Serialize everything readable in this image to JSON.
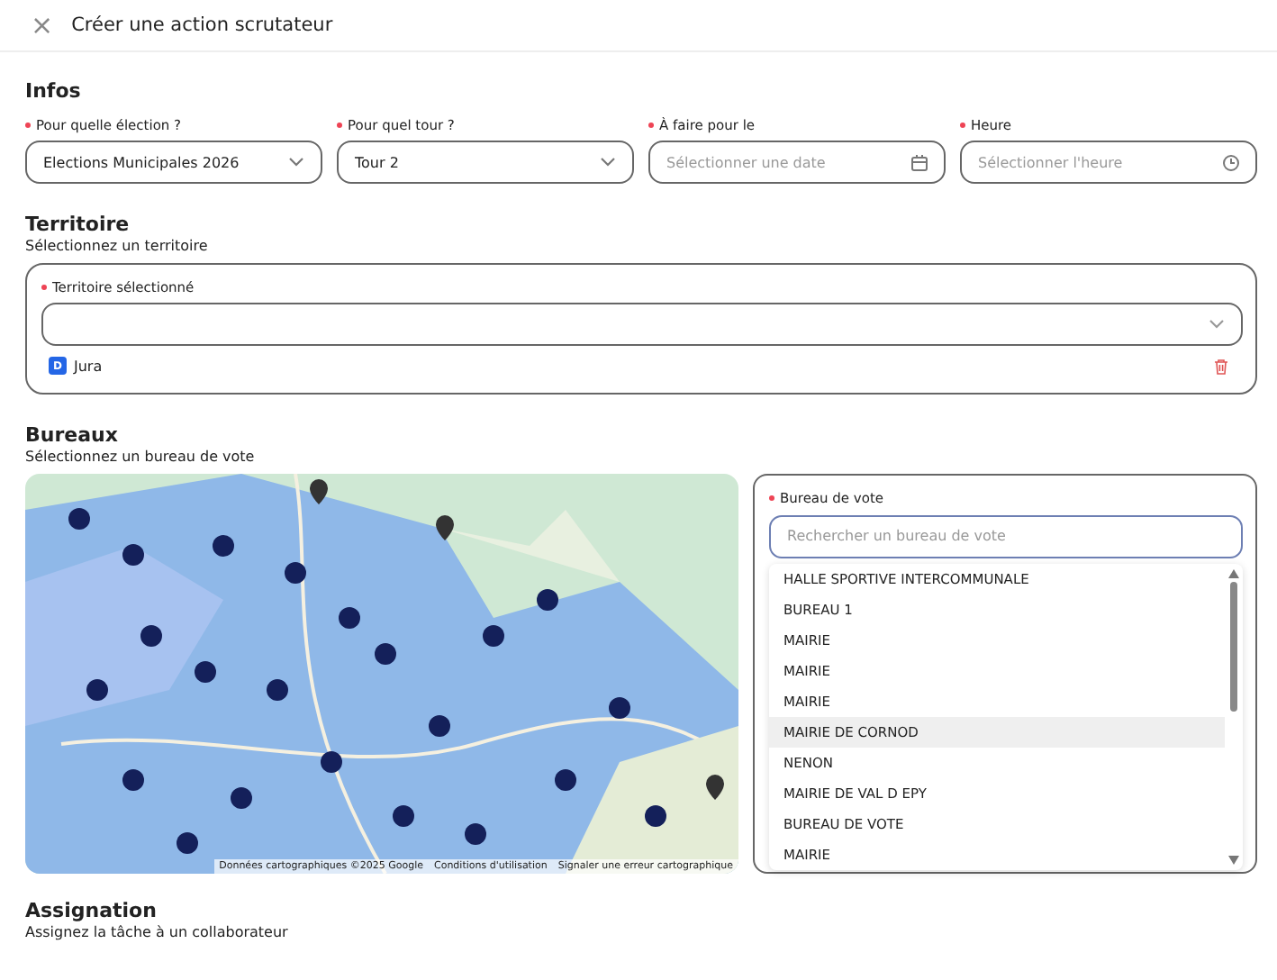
{
  "header": {
    "close_icon": "×",
    "title": "Créer une action scrutateur"
  },
  "infos": {
    "title": "Infos",
    "fields": [
      {
        "kind": "select",
        "label": "Pour quelle élection ?",
        "required": true,
        "value": "Elections Municipales 2026"
      },
      {
        "kind": "select",
        "label": "Pour quel tour ?",
        "required": true,
        "value": "Tour 2"
      },
      {
        "kind": "date",
        "label": "À faire pour le",
        "required": true,
        "placeholder": "Sélectionner une date"
      },
      {
        "kind": "time",
        "label": "Heure",
        "required": true,
        "placeholder": "Sélectionner l'heure"
      }
    ]
  },
  "territoire": {
    "title": "Territoire",
    "subtitle": "Sélectionnez un territoire",
    "field_label": "Territoire sélectionné",
    "required": true,
    "items": [
      {
        "badge": "D",
        "name": "Jura"
      }
    ]
  },
  "bureaux": {
    "title": "Bureaux",
    "subtitle": "Sélectionnez un bureau de vote",
    "map": {
      "kind": "picture",
      "attribution": [
        "Données cartographiques ©2025 Google",
        "Conditions d'utilisation",
        "Signaler une erreur cartographique"
      ]
    },
    "field_label": "Bureau de vote",
    "required": true,
    "placeholder": "Rechercher un bureau de vote",
    "options": [
      {
        "label": "HALLE SPORTIVE INTERCOMMUNALE",
        "selected": false
      },
      {
        "label": "BUREAU 1",
        "selected": false
      },
      {
        "label": "MAIRIE",
        "selected": false
      },
      {
        "label": "MAIRIE",
        "selected": false
      },
      {
        "label": "MAIRIE",
        "selected": false
      },
      {
        "label": "MAIRIE DE CORNOD",
        "selected": true
      },
      {
        "label": "NENON",
        "selected": false
      },
      {
        "label": "MAIRIE DE VAL D EPY",
        "selected": false
      },
      {
        "label": "BUREAU DE VOTE",
        "selected": false
      },
      {
        "label": "MAIRIE",
        "selected": false
      }
    ]
  },
  "assignation": {
    "title": "Assignation",
    "subtitle": "Assignez la tâche à un collaborateur"
  }
}
